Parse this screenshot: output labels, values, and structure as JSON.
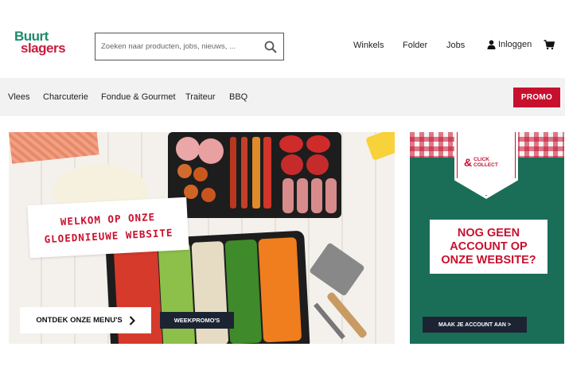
{
  "brand": {
    "line1": "Buurt",
    "line2": "slagers"
  },
  "search": {
    "placeholder": "Zoeken naar producten, jobs, nieuws, ..."
  },
  "top_nav": {
    "stores": "Winkels",
    "folder": "Folder",
    "jobs": "Jobs",
    "login": "Inloggen"
  },
  "categories": [
    "Vlees",
    "Charcuterie",
    "Fondue & Gourmet",
    "Traiteur",
    "BBQ"
  ],
  "promo_label": "PROMO",
  "hero": {
    "welcome_line1": "WELKOM OP ONZE",
    "welcome_line2": "GLOEDNIEUWE WEBSITE",
    "menus_button": "ONTDEK ONZE MENU'S",
    "weekpromos_button": "WEEKPROMO'S"
  },
  "side_card": {
    "badge_top": "CLICK",
    "badge_bottom": "COLLECT",
    "headline_1": "NOG GEEN",
    "headline_2": "ACCOUNT OP",
    "headline_3": "ONZE WEBSITE?",
    "cta": "MAAK JE ACCOUNT AAN >"
  },
  "colors": {
    "brand_red": "#c8102e",
    "brand_green": "#1a6e57",
    "dark_navy": "#1c2434"
  }
}
